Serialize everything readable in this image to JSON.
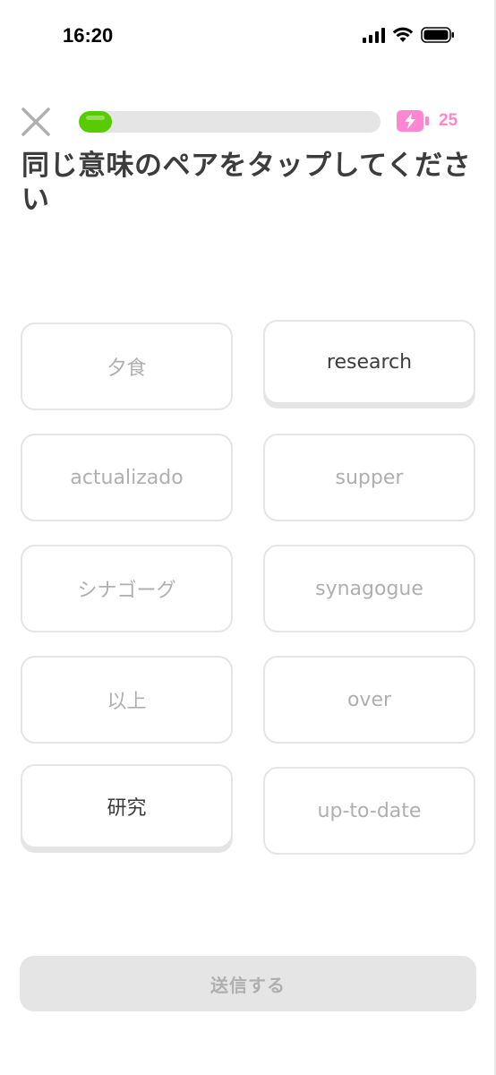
{
  "status_bar": {
    "time": "16:20"
  },
  "header": {
    "progress_fraction": 0.11,
    "energy_count": "25",
    "progress_color": "#58cc02",
    "energy_color": "#ff86d0"
  },
  "prompt": {
    "text": "同じ意味のペアをタップしてください"
  },
  "tiles": {
    "left": [
      {
        "label": "夕食",
        "active": false
      },
      {
        "label": "actualizado",
        "active": false
      },
      {
        "label": "シナゴーグ",
        "active": false
      },
      {
        "label": "以上",
        "active": false
      },
      {
        "label": "研究",
        "active": true
      }
    ],
    "right": [
      {
        "label": "research",
        "active": true
      },
      {
        "label": "supper",
        "active": false
      },
      {
        "label": "synagogue",
        "active": false
      },
      {
        "label": "over",
        "active": false
      },
      {
        "label": "up-to-date",
        "active": false
      }
    ]
  },
  "footer": {
    "submit_label": "送信する"
  },
  "icons": {
    "close": "close-icon",
    "energy": "energy-battery-icon",
    "signal": "signal-icon",
    "wifi": "wifi-icon",
    "battery": "battery-icon"
  }
}
